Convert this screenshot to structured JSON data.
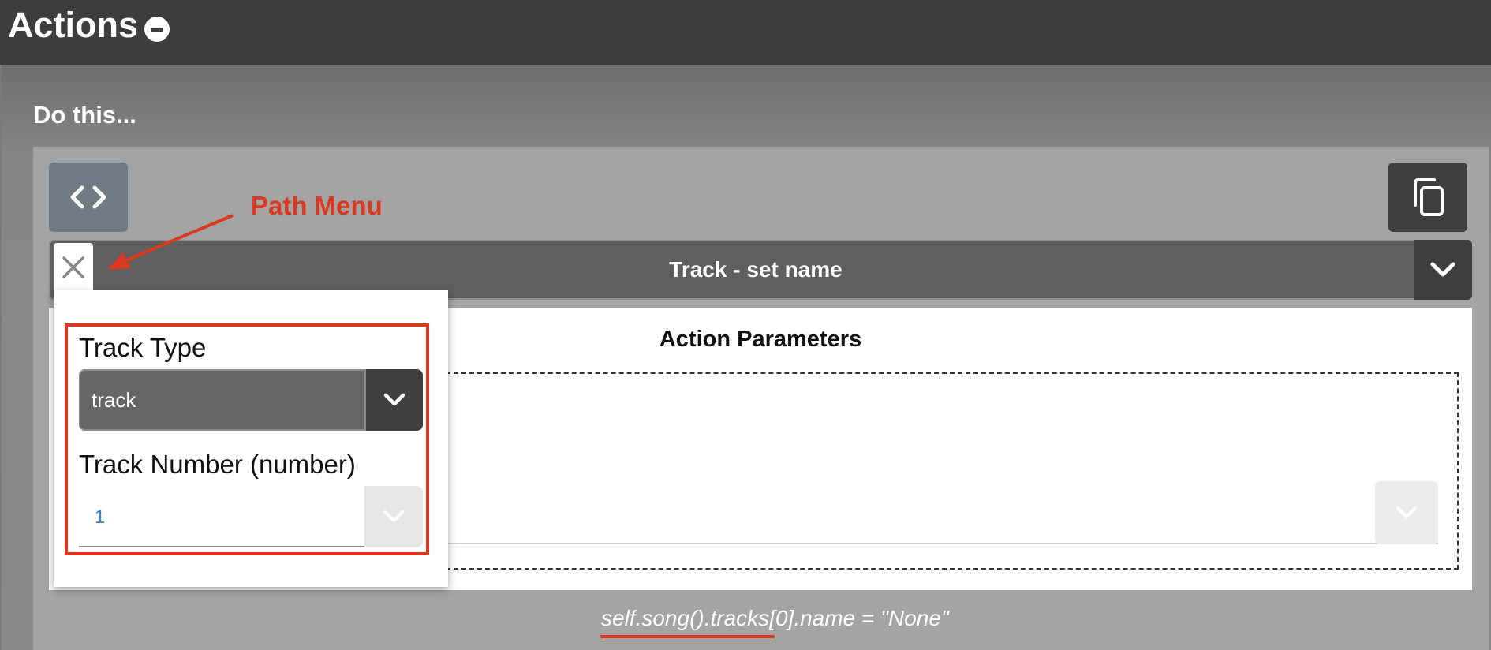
{
  "header": {
    "title": "Actions",
    "collapse_icon": "minus-circle-icon"
  },
  "section": {
    "label": "Do this..."
  },
  "toolbar": {
    "code_icon": "code-brackets-icon",
    "copy_icon": "copy-icon"
  },
  "action": {
    "selected": "Track - set name",
    "toggle_icon": "chevron-down-icon"
  },
  "params": {
    "title": "Action Parameters"
  },
  "path_menu": {
    "close_icon": "close-icon",
    "track_type": {
      "label": "Track Type",
      "value": "track"
    },
    "track_number": {
      "label": "Track Number (number)",
      "value": "1"
    }
  },
  "annotation": {
    "label": "Path Menu",
    "color": "#d9391e"
  },
  "path_expression": {
    "path": "self.song().tracks[0]",
    "suffix": ".name = \"None\""
  }
}
